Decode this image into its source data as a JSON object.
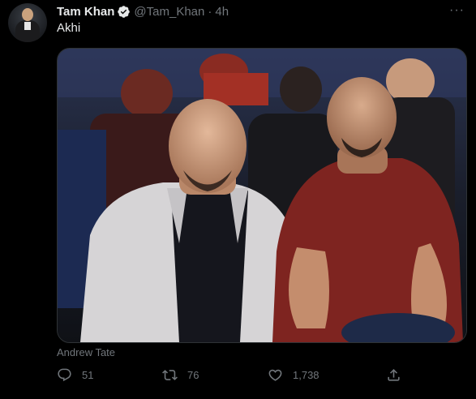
{
  "tweet": {
    "display_name": "Tam Khan",
    "handle": "@Tam_Khan",
    "separator": "·",
    "time": "4h",
    "text": "Akhi",
    "more_label": "···",
    "media_tag": "Andrew Tate",
    "stats": {
      "replies": "51",
      "retweets": "76",
      "likes": "1,738"
    }
  },
  "icons": {
    "verified": "verified-badge-icon",
    "more": "more-icon",
    "reply": "reply-icon",
    "retweet": "retweet-icon",
    "like": "heart-icon",
    "share": "share-icon"
  },
  "colors": {
    "background": "#000000",
    "text_primary": "#e7e9ea",
    "text_secondary": "#71767b",
    "border": "#2f3336"
  }
}
